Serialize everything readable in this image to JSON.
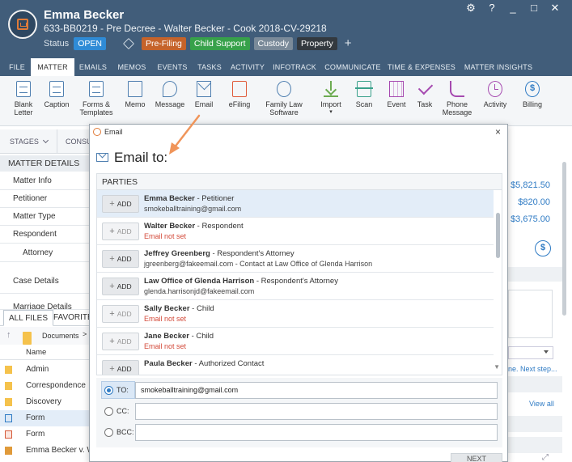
{
  "header": {
    "client_name": "Emma Becker",
    "matter_line": "633-BB0219 - Pre Decree - Walter Becker - Cook 2018-CV-29218",
    "status_label": "Status",
    "status_value": "OPEN",
    "tags": [
      "Pre-Filing",
      "Child Support",
      "Custody",
      "Property"
    ],
    "add_icon": "plus-icon",
    "window_controls": [
      "gear-icon",
      "?",
      "_",
      "□",
      "✕"
    ]
  },
  "tabs": [
    "FILE",
    "MATTER",
    "EMAILS",
    "MEMOS",
    "EVENTS",
    "TASKS",
    "ACTIVITY",
    "INFOTRACK",
    "COMMUNICATE",
    "TIME & EXPENSES",
    "MATTER INSIGHTS"
  ],
  "active_tab": "MATTER",
  "toolbar": {
    "blank_letter": [
      "Blank",
      "Letter"
    ],
    "caption": "Caption",
    "forms": [
      "Forms &",
      "Templates"
    ],
    "memo": "Memo",
    "message": "Message",
    "email": "Email",
    "efiling": "eFiling",
    "fls": [
      "Family Law",
      "Software"
    ],
    "import": "Import",
    "import_caret": "▾",
    "scan": "Scan",
    "event": "Event",
    "task": "Task",
    "phone": [
      "Phone",
      "Message"
    ],
    "activity": "Activity",
    "billing": "Billing"
  },
  "sidebar": {
    "stages": "STAGES",
    "consu": "CONSU",
    "matter_details": "MATTER DETAILS",
    "items": [
      "Matter Info",
      "Petitioner",
      "Matter Type",
      "Respondent",
      "Attorney",
      "Case Details",
      "Marriage Details"
    ]
  },
  "files": {
    "tabs": [
      "ALL FILES",
      "FAVORITES"
    ],
    "path": "Documents",
    "path_sep": ">",
    "up": "↑",
    "column": "Name",
    "rows": [
      "Admin",
      "Correspondence",
      "Discovery",
      "Form",
      "Form",
      "Emma Becker v. Wa"
    ]
  },
  "right_panel": {
    "amounts": [
      "$5,821.50",
      "$820.00",
      "$3,675.00"
    ],
    "next_step": "ne. Next step...",
    "view_all": "View all"
  },
  "modal": {
    "title": "Email",
    "close": "×",
    "heading": "Email to:",
    "parties_header": "PARTIES",
    "add_label": "ADD",
    "parties": [
      {
        "name": "Emma Becker",
        "role": " - Petitioner",
        "email": "smokeballtraining@gmail.com",
        "missing": false
      },
      {
        "name": "Walter Becker",
        "role": " - Respondent",
        "email": "Email not set",
        "missing": true
      },
      {
        "name": "Jeffrey Greenberg",
        "role": " - Respondent's Attorney",
        "email": "jgreenberg@fakeemail.com - Contact at Law Office of Glenda Harrison",
        "missing": false
      },
      {
        "name": "Law Office of Glenda Harrison",
        "role": " - Respondent's Attorney",
        "email": "glenda.harrisonjd@fakeemail.com",
        "missing": false
      },
      {
        "name": "Sally Becker",
        "role": " - Child",
        "email": "Email not set",
        "missing": true
      },
      {
        "name": "Jane Becker",
        "role": " - Child",
        "email": "Email not set",
        "missing": true
      },
      {
        "name": "Paula Becker",
        "role": " - Authorized Contact",
        "email": "",
        "missing": false
      }
    ],
    "to_label": "TO:",
    "to_value": "smokeballtraining@gmail.com",
    "cc_label": "CC:",
    "cc_value": "",
    "bcc_label": "BCC:",
    "bcc_value": "",
    "next_label": "NEXT"
  },
  "colors": {
    "header_bg": "#415d7a",
    "accent": "#2f7bc4",
    "arrow": "#f0955a",
    "missing_email": "#d34a3a"
  }
}
